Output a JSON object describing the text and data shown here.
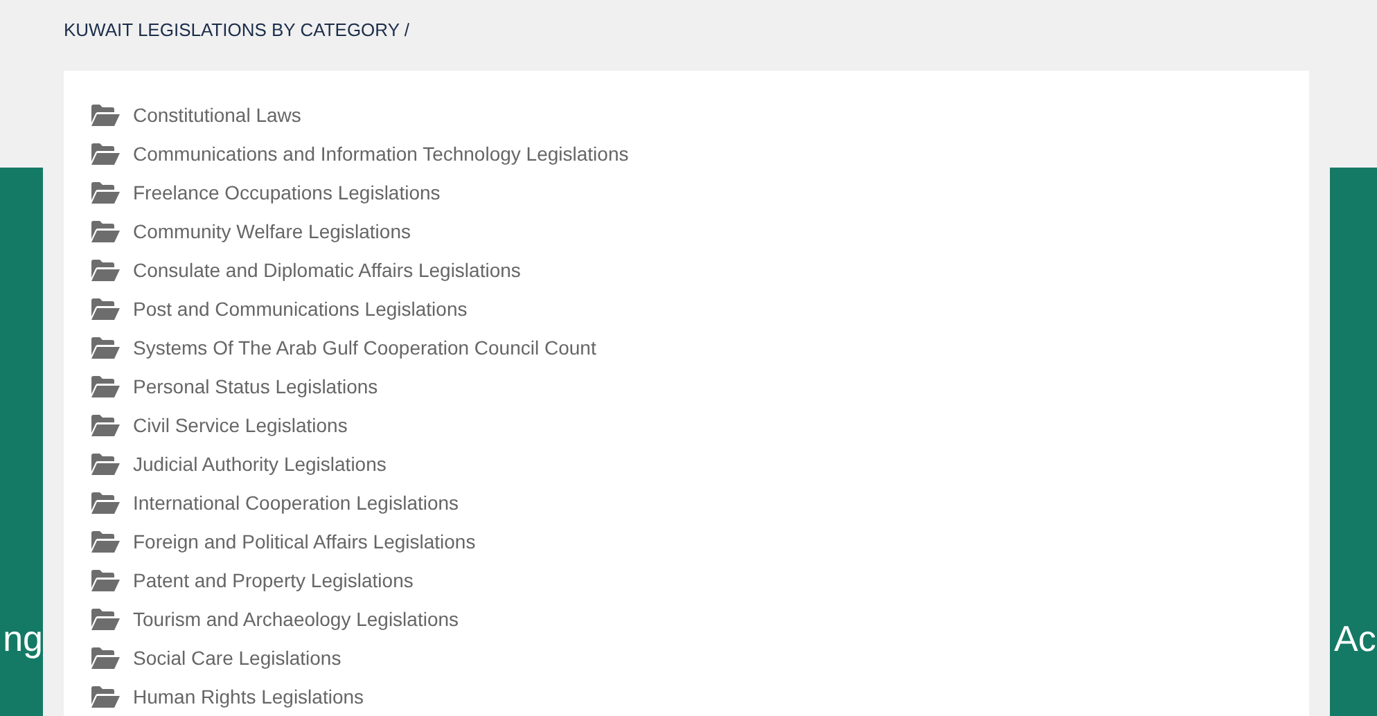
{
  "breadcrumb": "KUWAIT LEGISLATIONS BY CATEGORY /",
  "left_panel": {
    "text": "ng"
  },
  "right_panel": {
    "text": "Ac"
  },
  "categories": [
    {
      "label": "Constitutional Laws"
    },
    {
      "label": "Communications and Information Technology Legislations"
    },
    {
      "label": "Freelance Occupations Legislations"
    },
    {
      "label": "Community Welfare Legislations"
    },
    {
      "label": "Consulate and Diplomatic Affairs Legislations"
    },
    {
      "label": "Post and Communications Legislations"
    },
    {
      "label": "Systems Of The Arab Gulf Cooperation Council Count"
    },
    {
      "label": "Personal Status Legislations"
    },
    {
      "label": "Civil Service Legislations"
    },
    {
      "label": "Judicial Authority Legislations"
    },
    {
      "label": "International Cooperation Legislations"
    },
    {
      "label": "Foreign and Political Affairs Legislations"
    },
    {
      "label": "Patent and Property Legislations"
    },
    {
      "label": "Tourism and Archaeology Legislations"
    },
    {
      "label": "Social Care Legislations"
    },
    {
      "label": "Human Rights Legislations"
    }
  ]
}
